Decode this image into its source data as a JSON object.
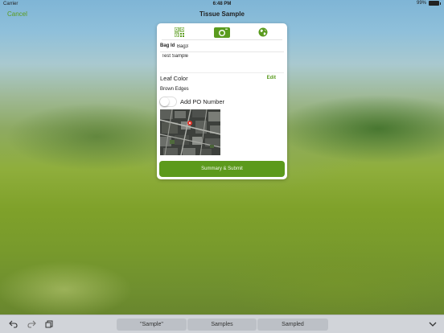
{
  "status_bar": {
    "carrier": "Carrier",
    "time": "6:48 PM",
    "battery": "99%"
  },
  "nav": {
    "cancel_label": "Cancel",
    "title": "Tissue Sample"
  },
  "tabs": [
    {
      "name": "qr-code",
      "icon": "qr-code-icon",
      "selected": false
    },
    {
      "name": "photo",
      "icon": "camera-icon",
      "selected": true
    },
    {
      "name": "location",
      "icon": "globe-icon",
      "selected": false
    }
  ],
  "form": {
    "bag_id_label": "Bag Id",
    "bag_id_value": "Bag3",
    "notes_value": "Test Sample",
    "leaf_color_label": "Leaf Color",
    "leaf_color_edit": "Edit",
    "leaf_color_value": "Brown Edges",
    "po_toggle_on": false,
    "po_label": "Add PO Number",
    "submit_label": "Summary & Submit"
  },
  "keyboard_bar": {
    "suggestions": [
      "\"Sample\"",
      "Samples",
      "Sampled"
    ],
    "icons": [
      "undo-icon",
      "redo-icon",
      "paste-icon",
      "chevron-down-icon"
    ]
  },
  "colors": {
    "accent": "#5a9b1e",
    "submit_bg": "#5c9a1c"
  }
}
